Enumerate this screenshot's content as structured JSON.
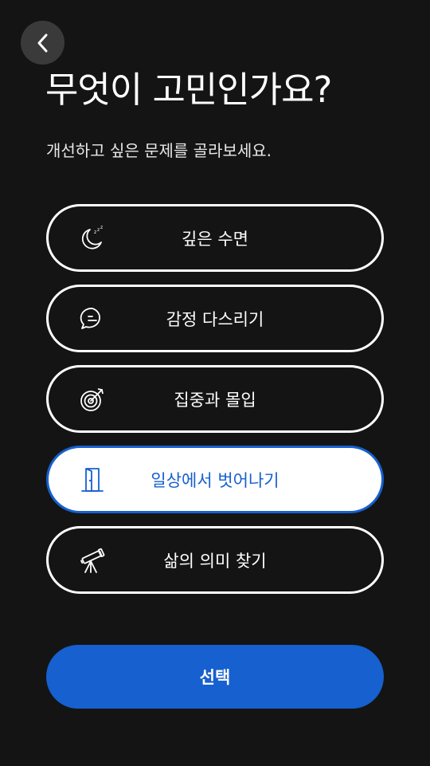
{
  "header": {
    "back_icon": "chevron-left-icon",
    "title": "무엇이 고민인가요?",
    "subtitle": "개선하고 싶은 문제를 골라보세요."
  },
  "options": [
    {
      "label": "깊은 수면",
      "icon": "moon-sleep-icon",
      "selected": false
    },
    {
      "label": "감정 다스리기",
      "icon": "chat-bubble-icon",
      "selected": false
    },
    {
      "label": "집중과 몰입",
      "icon": "target-arrow-icon",
      "selected": false
    },
    {
      "label": "일상에서 벗어나기",
      "icon": "door-icon",
      "selected": true
    },
    {
      "label": "삶의 의미 찾기",
      "icon": "telescope-icon",
      "selected": false
    }
  ],
  "footer": {
    "select_label": "선택"
  },
  "colors": {
    "background": "#141414",
    "accent": "#1660cf",
    "back_button_bg": "#3a3a3a",
    "text": "#ffffff"
  }
}
